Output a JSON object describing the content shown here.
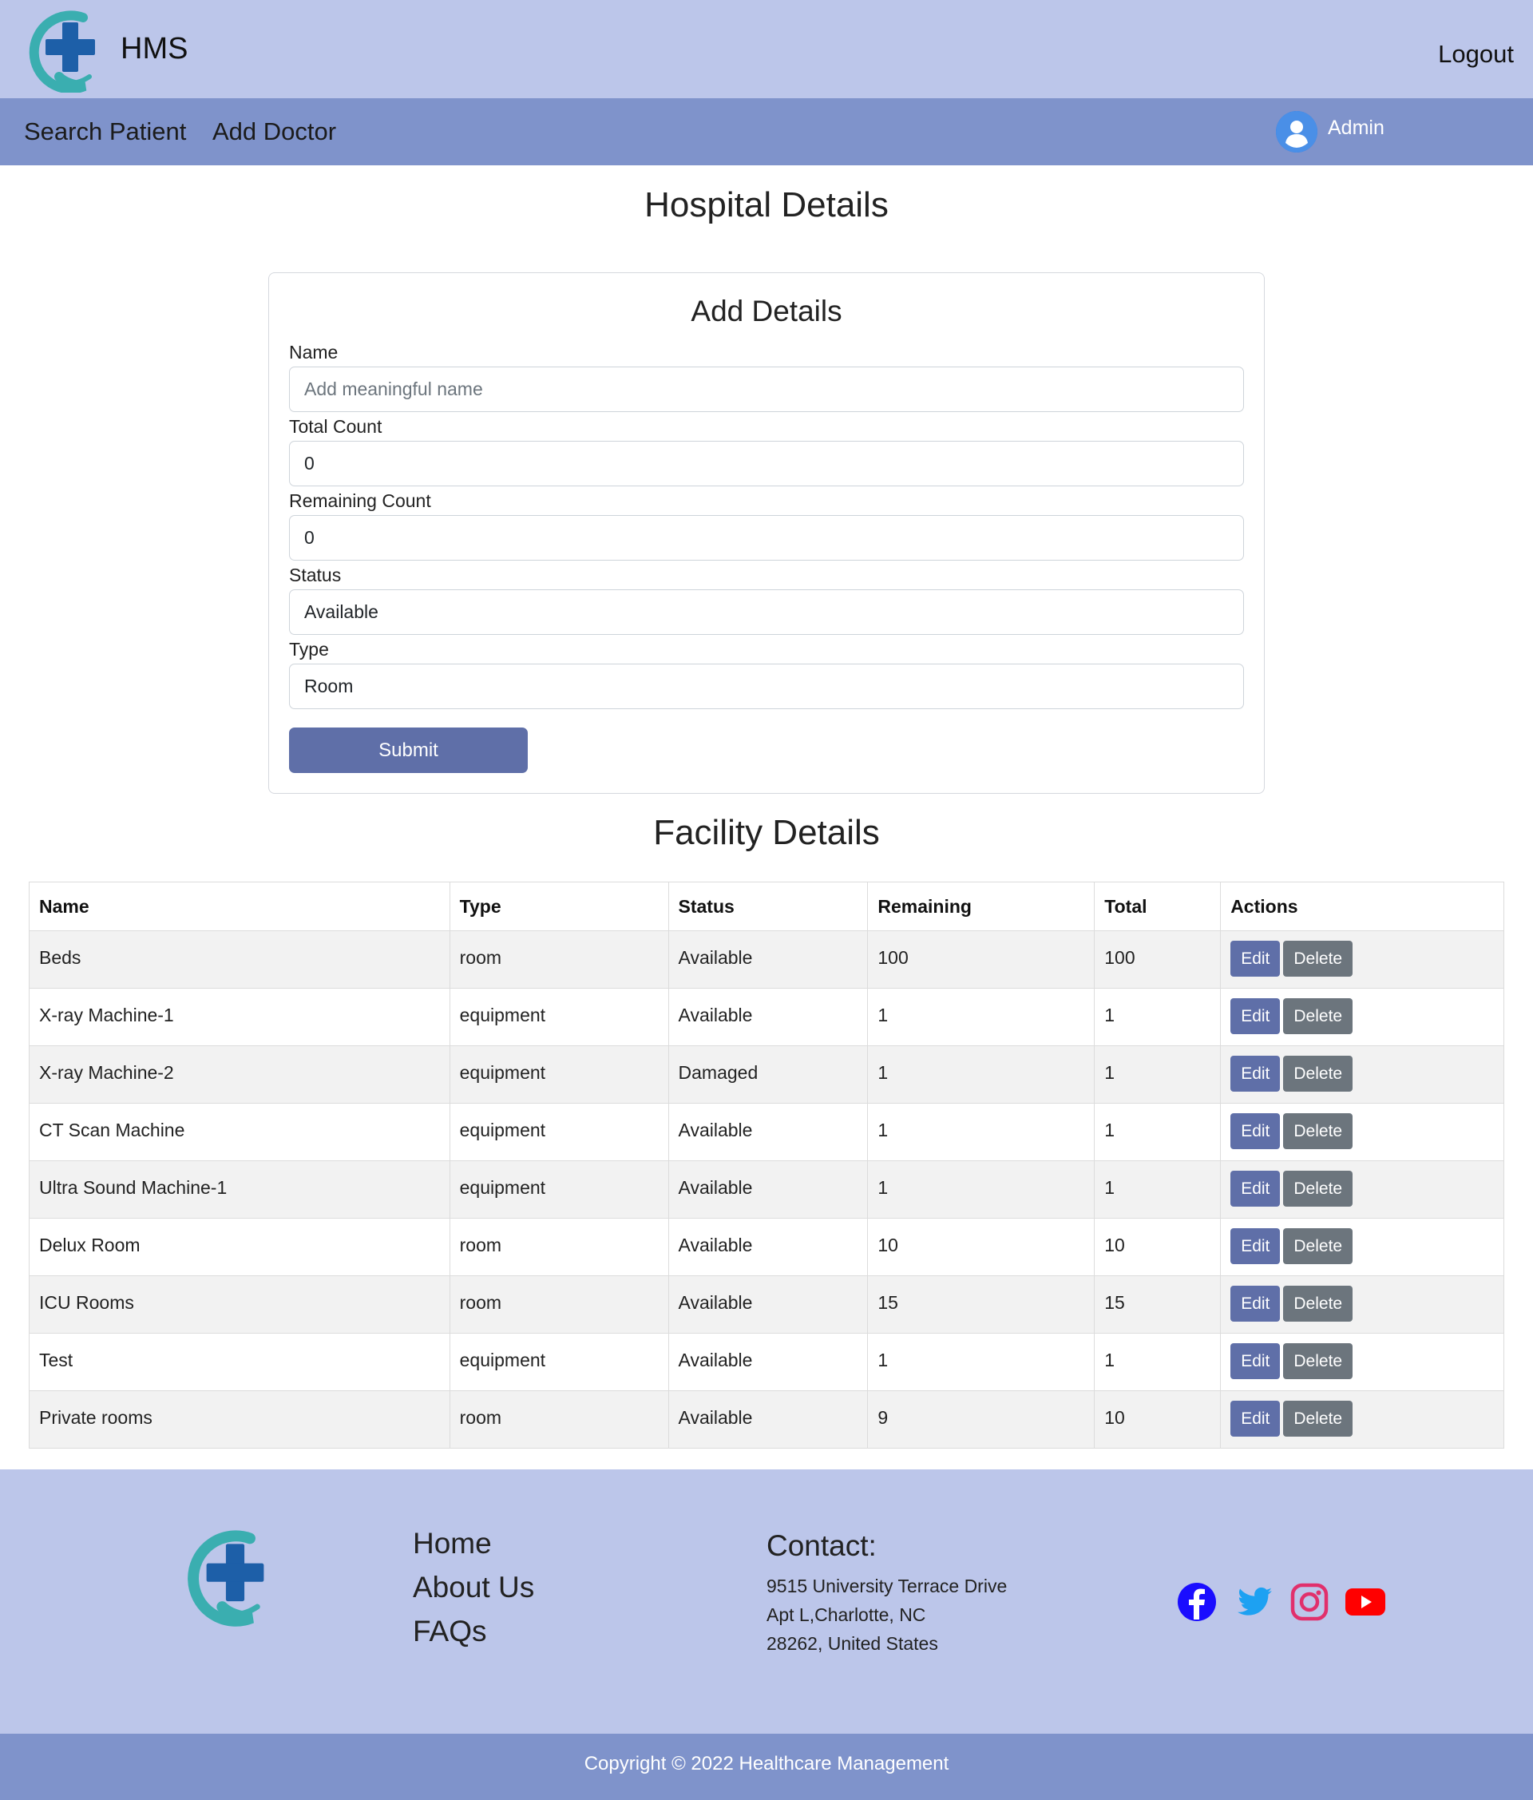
{
  "header": {
    "brand": "HMS",
    "logout_label": "Logout"
  },
  "nav": {
    "items": [
      {
        "label": "Search Patient"
      },
      {
        "label": "Add Doctor"
      }
    ],
    "user_label": "Admin"
  },
  "page": {
    "title": "Hospital Details"
  },
  "form": {
    "title": "Add Details",
    "fields": {
      "name": {
        "label": "Name",
        "placeholder": "Add meaningful name",
        "value": ""
      },
      "total_count": {
        "label": "Total Count",
        "value": "0"
      },
      "remaining_count": {
        "label": "Remaining Count",
        "value": "0"
      },
      "status": {
        "label": "Status",
        "value": "Available"
      },
      "type": {
        "label": "Type",
        "value": "Room"
      }
    },
    "submit_label": "Submit"
  },
  "facility": {
    "title": "Facility Details",
    "columns": [
      "Name",
      "Type",
      "Status",
      "Remaining",
      "Total",
      "Actions"
    ],
    "edit_label": "Edit",
    "delete_label": "Delete",
    "rows": [
      {
        "name": "Beds",
        "type": "room",
        "status": "Available",
        "remaining": "100",
        "total": "100"
      },
      {
        "name": "X-ray Machine-1",
        "type": "equipment",
        "status": "Available",
        "remaining": "1",
        "total": "1"
      },
      {
        "name": "X-ray Machine-2",
        "type": "equipment",
        "status": "Damaged",
        "remaining": "1",
        "total": "1"
      },
      {
        "name": "CT Scan Machine",
        "type": "equipment",
        "status": "Available",
        "remaining": "1",
        "total": "1"
      },
      {
        "name": "Ultra Sound Machine-1",
        "type": "equipment",
        "status": "Available",
        "remaining": "1",
        "total": "1"
      },
      {
        "name": "Delux Room",
        "type": "room",
        "status": "Available",
        "remaining": "10",
        "total": "10"
      },
      {
        "name": "ICU Rooms",
        "type": "room",
        "status": "Available",
        "remaining": "15",
        "total": "15"
      },
      {
        "name": "Test",
        "type": "equipment",
        "status": "Available",
        "remaining": "1",
        "total": "1"
      },
      {
        "name": "Private rooms",
        "type": "room",
        "status": "Available",
        "remaining": "9",
        "total": "10"
      }
    ]
  },
  "footer": {
    "links": [
      {
        "label": "Home"
      },
      {
        "label": "About Us"
      },
      {
        "label": "FAQs"
      }
    ],
    "contact_title": "Contact:",
    "address_lines": [
      "9515 University Terrace Drive",
      "Apt L,Charlotte, NC",
      "28262, United States"
    ],
    "social": [
      {
        "icon": "facebook-icon",
        "color": "#1a0dff"
      },
      {
        "icon": "twitter-icon",
        "color": "#1da1f2"
      },
      {
        "icon": "instagram-icon",
        "color": "#e1306c"
      },
      {
        "icon": "youtube-icon",
        "color": "#ff0000"
      }
    ],
    "copyright": "Copyright  © 2022 Healthcare Management"
  },
  "colors": {
    "header_bg": "#bcc6ea",
    "nav_bg": "#7f93cb",
    "primary_button": "#5f6fa8",
    "secondary_button": "#6c757d",
    "logo_teal": "#3aaeb0",
    "logo_blue": "#1d5fa8"
  }
}
